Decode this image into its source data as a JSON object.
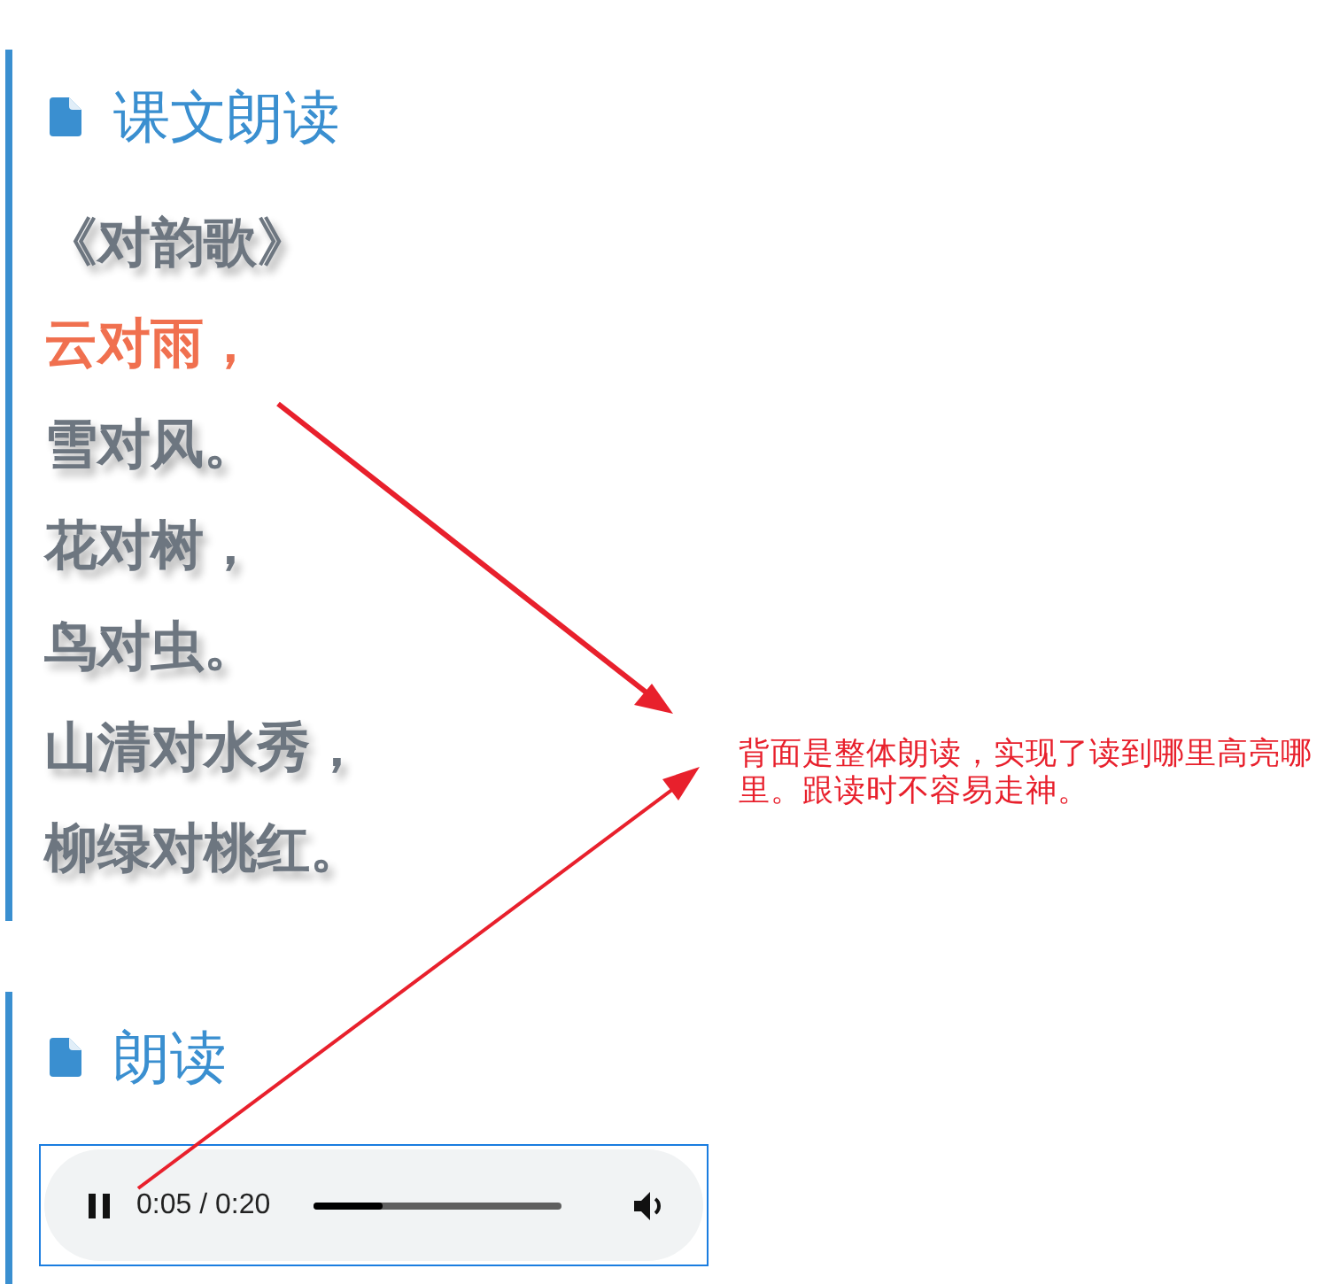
{
  "sections": [
    {
      "title": "课文朗读",
      "lines": [
        {
          "text": "《对韵歌》",
          "highlighted": false
        },
        {
          "text": "云对雨，",
          "highlighted": true
        },
        {
          "text": "雪对风。",
          "highlighted": false
        },
        {
          "text": "花对树，",
          "highlighted": false
        },
        {
          "text": "鸟对虫。",
          "highlighted": false
        },
        {
          "text": "山清对水秀，",
          "highlighted": false
        },
        {
          "text": "柳绿对桃红。",
          "highlighted": false
        }
      ]
    },
    {
      "title": "朗读",
      "player": {
        "playing": true,
        "time": "0:05 / 0:20",
        "level": 0.28
      }
    }
  ],
  "annotation": {
    "text": "背面是整体朗读，实现了读到哪里高亮哪里。跟读时不容易走神。"
  }
}
